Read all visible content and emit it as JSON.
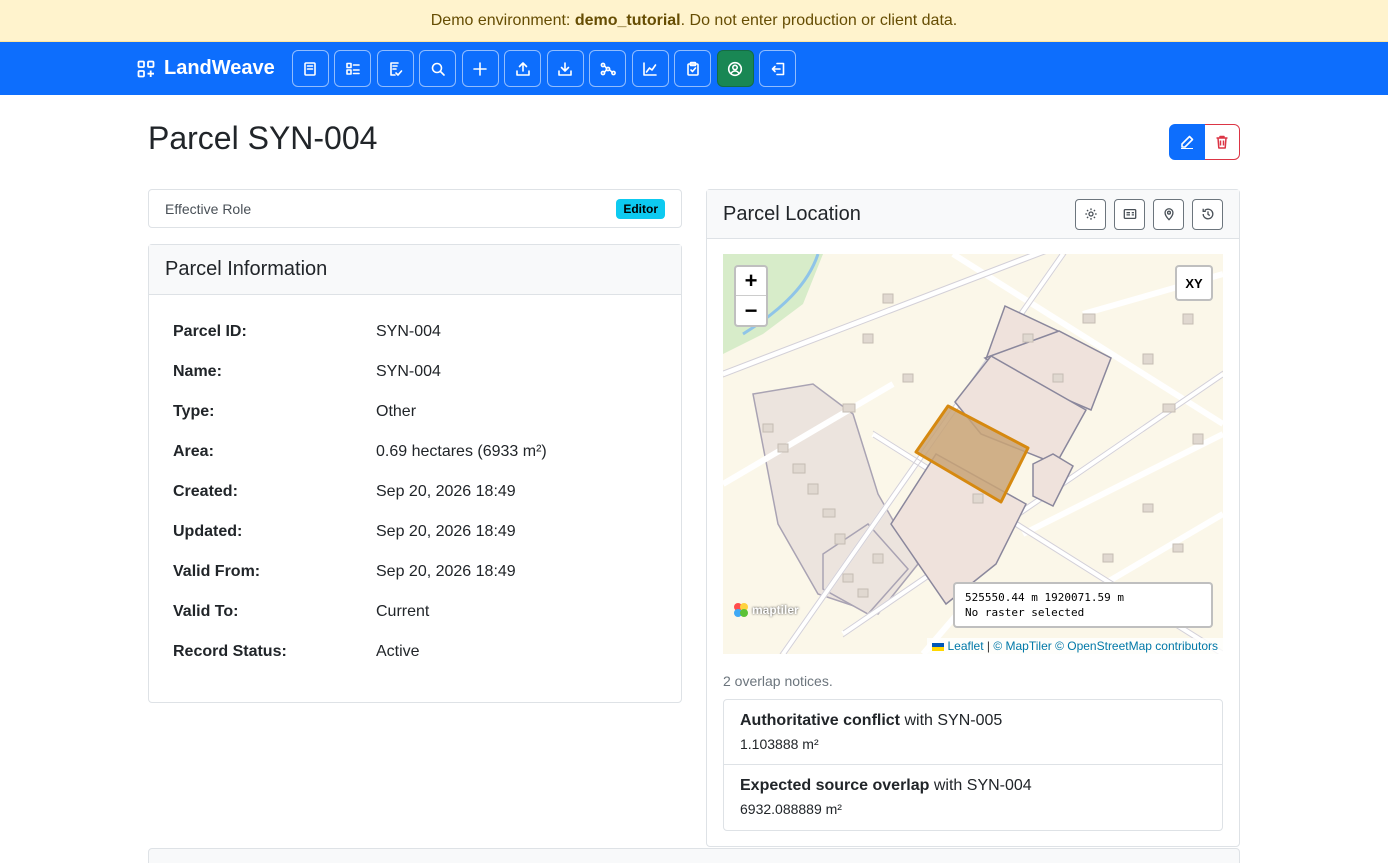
{
  "banner": {
    "prefix": "Demo environment: ",
    "env": "demo_tutorial",
    "suffix": ". Do not enter production or client data."
  },
  "nav": {
    "brand": "LandWeave",
    "buttons": [
      "book-icon",
      "list-icon",
      "checklist-icon",
      "search-icon",
      "plus-icon",
      "upload-icon",
      "download-icon",
      "network-icon",
      "chart-icon",
      "clipboard-icon",
      "account-icon",
      "logout-icon"
    ]
  },
  "page": {
    "title": "Parcel SYN-004"
  },
  "role": {
    "label": "Effective Role",
    "badge": "Editor"
  },
  "info": {
    "header": "Parcel Information",
    "rows": [
      {
        "key": "Parcel ID:",
        "value": "SYN-004"
      },
      {
        "key": "Name:",
        "value": "SYN-004"
      },
      {
        "key": "Type:",
        "value": "Other"
      },
      {
        "key": "Area:",
        "value": "0.69 hectares (6933 m²)"
      },
      {
        "key": "Created:",
        "value": "Sep 20, 2026 18:49"
      },
      {
        "key": "Updated:",
        "value": "Sep 20, 2026 18:49"
      },
      {
        "key": "Valid From:",
        "value": "Sep 20, 2026 18:49"
      },
      {
        "key": "Valid To:",
        "value": "Current"
      },
      {
        "key": "Record Status:",
        "value": "Active"
      }
    ]
  },
  "map_card": {
    "header": "Parcel Location",
    "zoom_in": "+",
    "zoom_out": "−",
    "xy_label": "XY",
    "coord_line1": "525550.44 m 1920071.59 m",
    "coord_line2": "No raster selected",
    "attrib_leaflet": "Leaflet",
    "attrib_sep": " | ",
    "attrib_rest": "© MapTiler © OpenStreetMap contributors",
    "logo_text": "maptiler"
  },
  "overlaps": {
    "count_text": "2 overlap notices.",
    "items": [
      {
        "kind": "Authoritative conflict",
        "with": " with SYN-005",
        "area": "1.103888 m²"
      },
      {
        "kind": "Expected source overlap",
        "with": " with SYN-004",
        "area": "6932.088889 m²"
      }
    ]
  }
}
